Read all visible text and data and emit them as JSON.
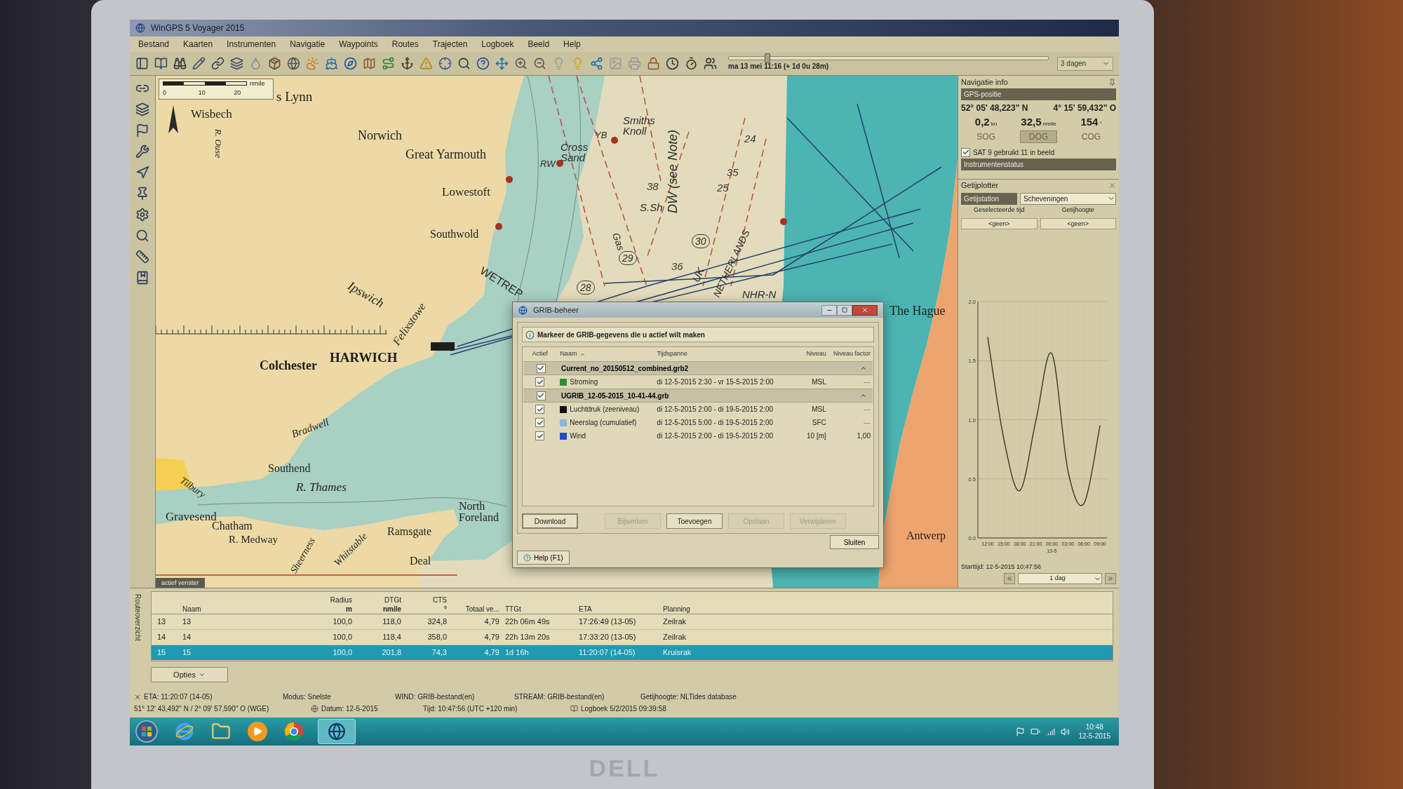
{
  "laptop": {
    "brand": "DELL"
  },
  "window": {
    "title": "WinGPS 5 Voyager 2015"
  },
  "menu": [
    "Bestand",
    "Kaarten",
    "Instrumenten",
    "Navigatie",
    "Waypoints",
    "Routes",
    "Trajecten",
    "Logboek",
    "Beeld",
    "Help"
  ],
  "time_bar": {
    "slider": {
      "level": 0.12
    },
    "label": "ma 13 mei 11:16 (+ 1d 0u 28m)",
    "range": "3 dagen"
  },
  "chart_view": {
    "scale_bar": {
      "ticks": [
        "0",
        "10",
        "20"
      ],
      "unit": "nmile"
    },
    "labels": [
      {
        "text": "s Lynn",
        "kind": "town"
      },
      {
        "text": "Wisbech",
        "kind": "town"
      },
      {
        "text": "R. Ouse",
        "kind": "town"
      },
      {
        "text": "Norwich",
        "kind": "town"
      },
      {
        "text": "Great Yarmouth",
        "kind": "town"
      },
      {
        "text": "Lowestoft",
        "kind": "town"
      },
      {
        "text": "Southwold",
        "kind": "town"
      },
      {
        "text": "Ipswich",
        "kind": "town"
      },
      {
        "text": "Felixstowe",
        "kind": "town"
      },
      {
        "text": "HARWICH",
        "kind": "town"
      },
      {
        "text": "Colchester",
        "kind": "town"
      },
      {
        "text": "Bradwell",
        "kind": "town"
      },
      {
        "text": "Southend",
        "kind": "town"
      },
      {
        "text": "R. Thames",
        "kind": "town"
      },
      {
        "text": "Tilbury",
        "kind": "town"
      },
      {
        "text": "Gravesend",
        "kind": "town"
      },
      {
        "text": "Chatham",
        "kind": "town"
      },
      {
        "text": "R. Medway",
        "kind": "town"
      },
      {
        "text": "Sheerness",
        "kind": "town"
      },
      {
        "text": "Whitstable",
        "kind": "town"
      },
      {
        "text": "Ramsgate",
        "kind": "town"
      },
      {
        "text": "North Foreland",
        "kind": "town"
      },
      {
        "text": "Deal",
        "kind": "town"
      },
      {
        "text": "Smiths Knoll",
        "kind": "sea"
      },
      {
        "text": "Cross Sand",
        "kind": "sea"
      },
      {
        "text": "NHR-N",
        "kind": "sea"
      },
      {
        "text": "The Hague",
        "kind": "town"
      },
      {
        "text": "Antwerp",
        "kind": "town"
      },
      {
        "text": "DW (see Note)",
        "kind": "sea"
      },
      {
        "text": "S.Sh",
        "kind": "sea"
      },
      {
        "text": "Gas",
        "kind": "sea"
      },
      {
        "text": "WETREP",
        "kind": "sea"
      },
      {
        "text": "UK",
        "kind": "sea"
      },
      {
        "text": "NETHERLANDS",
        "kind": "sea"
      },
      {
        "text": "RW",
        "kind": "sea"
      },
      {
        "text": "YB",
        "kind": "sea"
      },
      {
        "text": "38",
        "kind": "depth"
      },
      {
        "text": "35",
        "kind": "depth"
      },
      {
        "text": "24",
        "kind": "depth"
      },
      {
        "text": "36",
        "kind": "depth"
      },
      {
        "text": "25",
        "kind": "depth"
      },
      {
        "text": "28",
        "kind": "circled"
      },
      {
        "text": "29",
        "kind": "circled"
      },
      {
        "text": "30",
        "kind": "circled"
      }
    ],
    "active_tab": "actief venster"
  },
  "navigation_info": {
    "title": "Navigatie info",
    "gps_section": "GPS-positie",
    "latitude": "52° 05' 48,223\" N",
    "longitude": "4° 15' 59,432\" O",
    "readouts": [
      {
        "value": "0,2",
        "unit": "kn",
        "label": "SOG",
        "selected": false
      },
      {
        "value": "32,5",
        "unit": "nmile",
        "label": "DOG",
        "selected": true
      },
      {
        "value": "154",
        "unit": "°",
        "label": "COG",
        "selected": false
      }
    ],
    "satellites": {
      "text": "SAT 9 gebruikt 11 in beeld",
      "checked": true
    },
    "instrument_section": "Instrumentenstatus"
  },
  "tide_plotter": {
    "title": "Getijplotter",
    "station_label": "Getijstation",
    "station": "Scheveningen",
    "selected_time_label": "Geselecteerde tijd",
    "height_label": "Getijhoogte",
    "selected_time": "<geen>",
    "height": "<geen>",
    "chart_data": {
      "type": "line",
      "grid": true,
      "categories": [
        "12:00",
        "15:00",
        "18:00",
        "21:00",
        "00:00",
        "03:00",
        "06:00",
        "09:00"
      ],
      "values": [
        1.7,
        0.84,
        0.4,
        0.99,
        1.56,
        0.57,
        0.29,
        0.95
      ],
      "ylim": [
        0,
        2
      ],
      "yticks": [
        {
          "value": 0,
          "label": "0.0"
        },
        {
          "value": 0.5,
          "label": "0.5"
        },
        {
          "value": 1,
          "label": "1.0"
        },
        {
          "value": 1.5,
          "label": "1.5"
        },
        {
          "value": 2,
          "label": "2.0"
        }
      ]
    },
    "date_marker": "13-5",
    "start_time": "Starttijd: 12-5-2015 10:47:56",
    "period": "1 dag"
  },
  "grib_dialog": {
    "title": "GRIB-beheer",
    "instruction": "Markeer de GRIB-gegevens die u actief wilt maken",
    "columns": [
      "Actief",
      "Naam",
      "Tijdspanne",
      "Niveau",
      "Niveau factor"
    ],
    "groups": [
      {
        "name": "Current_no_20150512_combined.grb2",
        "checked": true,
        "expanded": true,
        "children": [
          {
            "name": "Stroming",
            "color": "#2e8b3a",
            "checked": true,
            "timespan": "di 12-5-2015 2:30 - vr 15-5-2015 2:00",
            "niveau": "MSL",
            "factor": "—"
          }
        ]
      },
      {
        "name": "UGRIB_12-05-2015_10-41-44.grb",
        "checked": true,
        "expanded": true,
        "children": [
          {
            "name": "Luchtdruk (zeeniveau)",
            "color": "#111111",
            "checked": true,
            "timespan": "di 12-5-2015 2:00 - di 19-5-2015 2:00",
            "niveau": "MSL",
            "factor": "—"
          },
          {
            "name": "Neerslag (cumulatief)",
            "color": "#8fb3d9",
            "checked": true,
            "timespan": "di 12-5-2015 5:00 - di 19-5-2015 2:00",
            "niveau": "SFC",
            "factor": "—"
          },
          {
            "name": "Wind",
            "color": "#1f4fc4",
            "checked": true,
            "timespan": "di 12-5-2015 2:00 - di 19-5-2015 2:00",
            "niveau": "10 [m]",
            "factor": "1,00"
          }
        ]
      }
    ],
    "buttons": [
      {
        "label": "Download",
        "disabled": false,
        "default": true
      },
      {
        "label": "Bijwerken",
        "disabled": true,
        "default": false
      },
      {
        "label": "Toevoegen",
        "disabled": false,
        "default": false
      },
      {
        "label": "Opslaan",
        "disabled": true,
        "default": false
      },
      {
        "label": "Verwijderen",
        "disabled": true,
        "default": false
      }
    ],
    "close_button": "Sluiten",
    "help_button": "Help (F1)"
  },
  "route_overview": {
    "side_label": "Routeoverzicht",
    "columns": [
      {
        "label": "Naam"
      },
      {
        "label": "Radius",
        "unit": "m"
      },
      {
        "label": "DTGt",
        "unit": "nmile"
      },
      {
        "label": "CTS",
        "unit": "°"
      },
      {
        "label": "Totaal ve..."
      },
      {
        "label": "TTGt"
      },
      {
        "label": "ETA"
      },
      {
        "label": "Planning"
      }
    ],
    "rows": [
      {
        "number": "13",
        "selected": false,
        "cells": [
          "13",
          "100,0",
          "118,0",
          "324,8",
          "4,79",
          "22h 06m 49s",
          "17:26:49 (13-05)",
          "Zeilrak"
        ]
      },
      {
        "number": "14",
        "selected": false,
        "cells": [
          "14",
          "100,0",
          "118,4",
          "358,0",
          "4,79",
          "22h 13m 20s",
          "17:33:20 (13-05)",
          "Zeilrak"
        ]
      },
      {
        "number": "15",
        "selected": true,
        "cells": [
          "15",
          "100,0",
          "201,8",
          "74,3",
          "4,79",
          "1d 16h",
          "11:20:07 (14-05)",
          "Kruisrak"
        ]
      }
    ],
    "options_button": "Opties"
  },
  "status_bar": {
    "eta": "ETA: 11:20:07 (14-05)",
    "mode": "Modus: Snelste",
    "wind": "WIND: GRIB-bestand(en)",
    "stream": "STREAM: GRIB-bestand(en)",
    "tide": "Getijhoogte: NLTides database",
    "position": "51° 12' 43,492\" N / 2° 09' 57,590\" O (WGE)",
    "date": "Datum: 12-5-2015",
    "time": "Tijd: 10:47:56 (UTC +120 min)",
    "logbook": "Logboek 5/2/2015 09:39:58"
  },
  "taskbar": {
    "time": "10:48",
    "date": "12-5-2015"
  }
}
